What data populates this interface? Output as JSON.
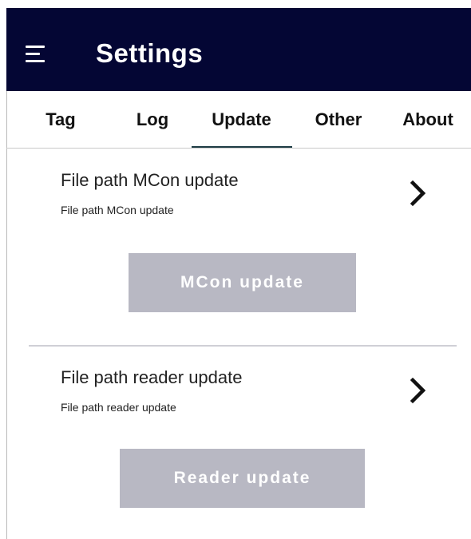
{
  "header": {
    "title": "Settings",
    "menu_icon": "hamburger-menu-icon",
    "background_color": "#040634"
  },
  "tabs": [
    {
      "label": "Tag",
      "active": false
    },
    {
      "label": "Log",
      "active": false
    },
    {
      "label": "Update",
      "active": true
    },
    {
      "label": "Other",
      "active": false
    },
    {
      "label": "About",
      "active": false
    }
  ],
  "sections": [
    {
      "title": "File path MCon update",
      "subtitle": "File path MCon update",
      "chevron_icon": "chevron-right-icon",
      "button_label": "MCon update",
      "button_enabled": false
    },
    {
      "title": "File path reader update",
      "subtitle": "File path reader update",
      "chevron_icon": "chevron-right-icon",
      "button_label": "Reader update",
      "button_enabled": false
    }
  ],
  "colors": {
    "accent_indicator": "#1f3d45",
    "disabled_button": "#b8b8c3"
  }
}
